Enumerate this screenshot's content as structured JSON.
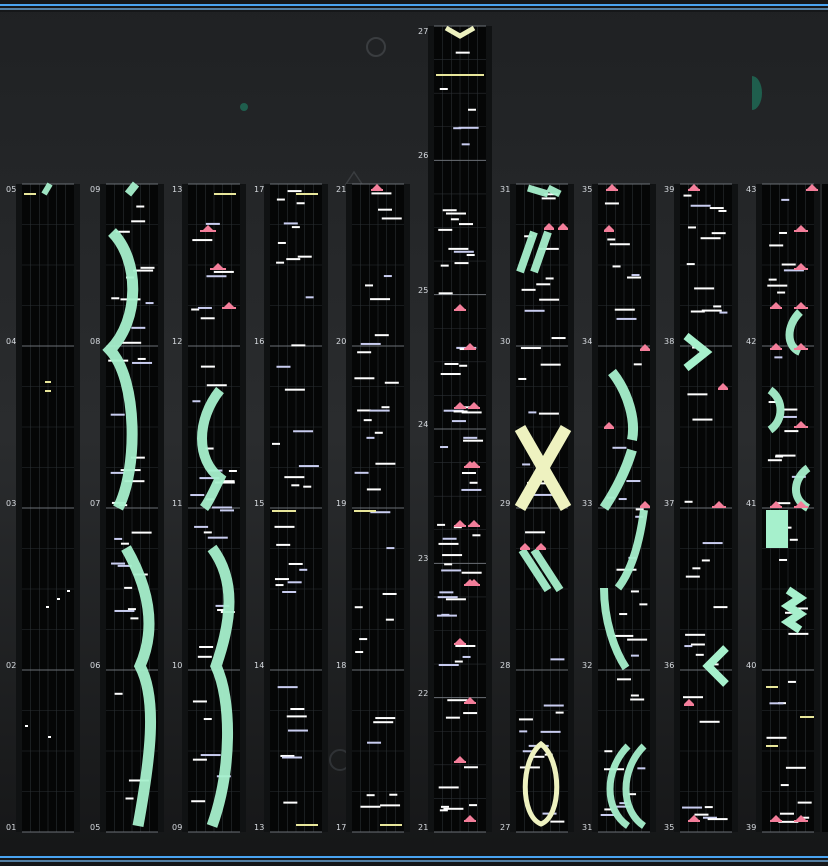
{
  "colors": {
    "background": "#202224",
    "lane_bg": "#050606",
    "lane_gutter": "#101213",
    "grid_line": "#2b2f33",
    "measure_line": "#6b7076",
    "tap_note": "#ffffff",
    "tap_note_alt": "#c9cdf0",
    "flick_note": "#f37e9a",
    "hold_body": "#a6f0cc",
    "hold_body_alt": "#eef2c0",
    "yellow_note": "#e8e69a",
    "frame_accent": "#4aa4f2",
    "decor": "#1f5e4d"
  },
  "columns": [
    {
      "labels": [
        "05",
        "04",
        "03",
        "02",
        "01"
      ]
    },
    {
      "labels": [
        "09",
        "08",
        "07",
        "06",
        "05"
      ]
    },
    {
      "labels": [
        "13",
        "12",
        "11",
        "10",
        "09"
      ]
    },
    {
      "labels": [
        "17",
        "16",
        "15",
        "14",
        "13"
      ]
    },
    {
      "labels": [
        "21",
        "20",
        "19",
        "18",
        "17"
      ]
    },
    {
      "labels": [
        "27",
        "26",
        "25",
        "24",
        "23",
        "22",
        "21"
      ]
    },
    {
      "labels": [
        "31",
        "30",
        "29",
        "28",
        "27"
      ]
    },
    {
      "labels": [
        "35",
        "34",
        "33",
        "32",
        "31"
      ]
    },
    {
      "labels": [
        "39",
        "38",
        "37",
        "36",
        "35"
      ]
    },
    {
      "labels": [
        "43",
        "42",
        "41",
        "40",
        "39"
      ]
    }
  ]
}
